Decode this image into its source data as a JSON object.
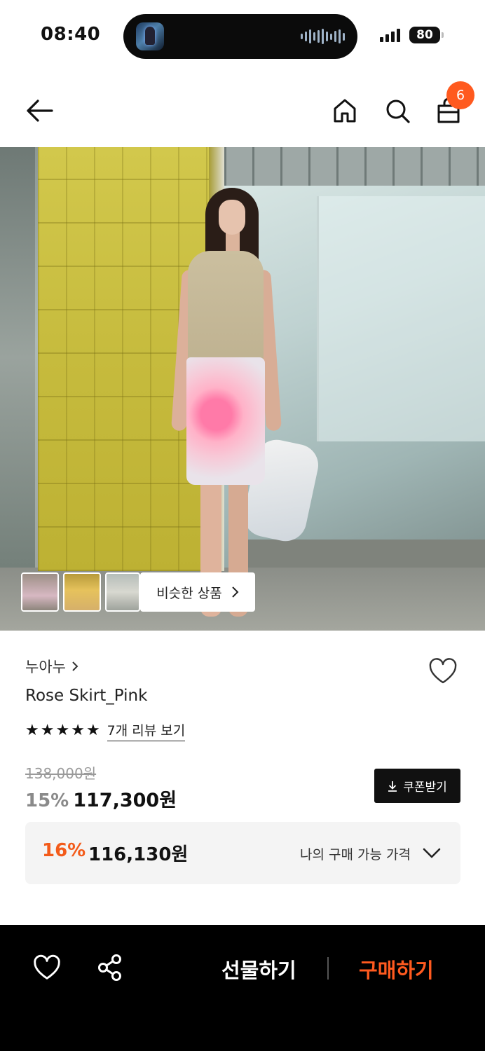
{
  "status_bar": {
    "time": "08:40",
    "battery": "80"
  },
  "header": {
    "cart_count": "6",
    "icons": [
      "back-arrow-icon",
      "home-icon",
      "search-icon",
      "shopping-bag-icon"
    ]
  },
  "hero": {
    "similar_products_label": "비슷한 상품"
  },
  "product": {
    "brand": "누아누",
    "name": "Rose Skirt_Pink",
    "rating_stars": 5,
    "review_link": "7개 리뷰 보기",
    "original_price": "138,000원",
    "discount_rate": "15%",
    "sale_price": "117,300원",
    "coupon_label": "쿠폰받기"
  },
  "best_price": {
    "discount_rate": "16%",
    "price": "116,130원",
    "label": "나의 구매 가능 가격"
  },
  "bottom_bar": {
    "gift_label": "선물하기",
    "buy_label": "구매하기"
  },
  "colors": {
    "accent": "#ff5a1f",
    "discount_orange": "#f35b1a",
    "bar_bg": "#000000"
  }
}
